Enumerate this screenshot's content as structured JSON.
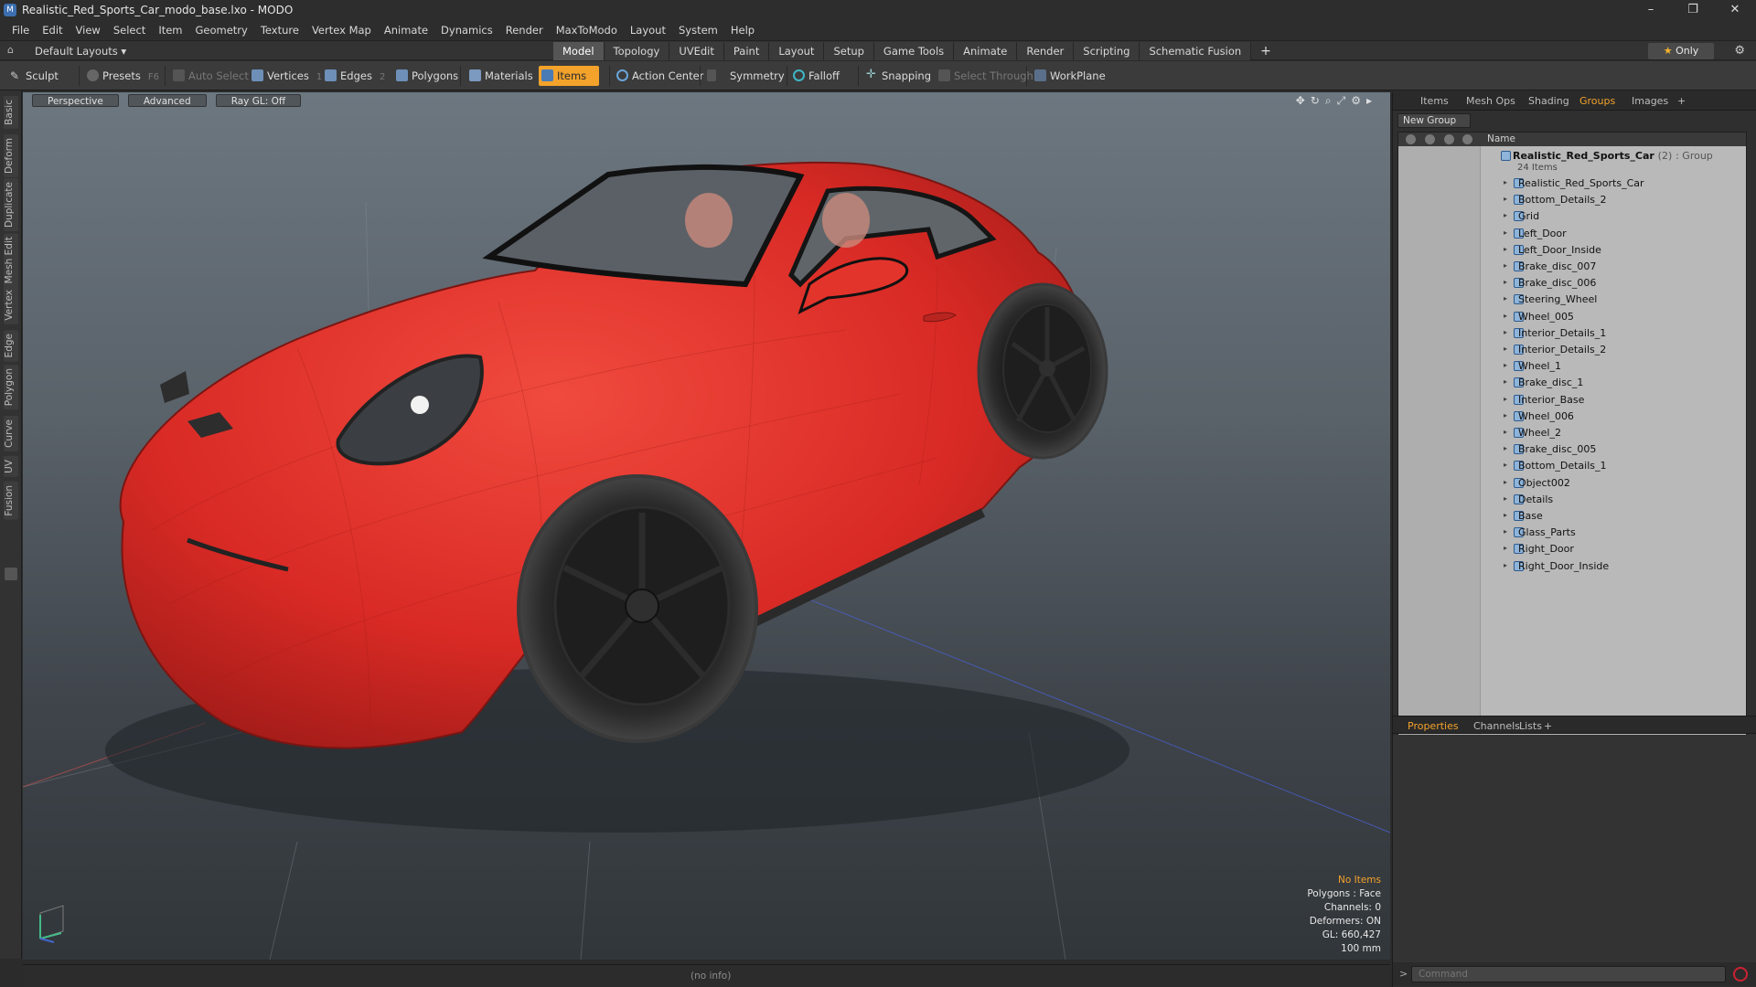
{
  "window": {
    "title": "Realistic_Red_Sports_Car_modo_base.lxo - MODO",
    "controls": [
      "–",
      "❐",
      "✕"
    ]
  },
  "menu": [
    "File",
    "Edit",
    "View",
    "Select",
    "Item",
    "Geometry",
    "Texture",
    "Vertex Map",
    "Animate",
    "Dynamics",
    "Render",
    "MaxToModo",
    "Layout",
    "System",
    "Help"
  ],
  "layout_bar": {
    "layouts_label": "Default Layouts ▾",
    "tabs": [
      "Model",
      "Topology",
      "UVEdit",
      "Paint",
      "Layout",
      "Setup",
      "Game Tools",
      "Animate",
      "Render",
      "Scripting",
      "Schematic Fusion"
    ],
    "active_tab": "Model",
    "add_tab": "+",
    "only_label": "Only"
  },
  "toolbar": {
    "sculpt": "Sculpt",
    "presets": "Presets",
    "presets_key": "F6",
    "auto_select": "Auto Select",
    "vertices": "Vertices",
    "vertices_key": "1",
    "edges": "Edges",
    "edges_key": "2",
    "polygons": "Polygons",
    "materials": "Materials",
    "items": "Items",
    "action_center": "Action Center",
    "symmetry": "Symmetry",
    "falloff": "Falloff",
    "snapping": "Snapping",
    "select_through": "Select Through",
    "workplane": "WorkPlane"
  },
  "left_tabs": [
    "Basic",
    "Deform",
    "Duplicate",
    "Mesh Edit",
    "Vertex",
    "Edge",
    "Polygon",
    "Curve",
    "UV",
    "Fusion"
  ],
  "viewport": {
    "perspective": "Perspective",
    "advanced": "Advanced",
    "raygl": "Ray GL: Off",
    "info": {
      "no_items": "No Items",
      "polygons": "Polygons : Face",
      "channels": "Channels: 0",
      "deformers": "Deformers: ON",
      "gl": "GL: 660,427",
      "scale": "100 mm"
    }
  },
  "status": {
    "info": "(no info)"
  },
  "right_panel": {
    "tabs": [
      "Items",
      "Mesh Ops",
      "Shading",
      "Groups",
      "Images",
      "+"
    ],
    "active_tab": "Groups",
    "new_group": "New Group",
    "name_header": "Name",
    "root": {
      "name": "Realistic_Red_Sports_Car",
      "count": "(2)",
      "kind": ": Group",
      "items_count": "24 Items"
    },
    "items": [
      "Realistic_Red_Sports_Car",
      "Bottom_Details_2",
      "Grid",
      "Left_Door",
      "Left_Door_Inside",
      "Brake_disc_007",
      "Brake_disc_006",
      "Steering_Wheel",
      "Wheel_005",
      "Interior_Details_1",
      "Interior_Details_2",
      "Wheel_1",
      "Brake_disc_1",
      "Interior_Base",
      "Wheel_006",
      "Wheel_2",
      "Brake_disc_005",
      "Bottom_Details_1",
      "Object002",
      "Details",
      "Base",
      "Glass_Parts",
      "Right_Door",
      "Right_Door_Inside"
    ],
    "props_tabs": [
      "Properties",
      "Channels",
      "Lists",
      "+"
    ],
    "props_active": "Properties",
    "command_placeholder": "Command",
    "command_prompt": ">"
  },
  "colors": {
    "accent": "#f3a22b",
    "car_body": "#e2302b",
    "viewport_top": "#6c7780"
  }
}
